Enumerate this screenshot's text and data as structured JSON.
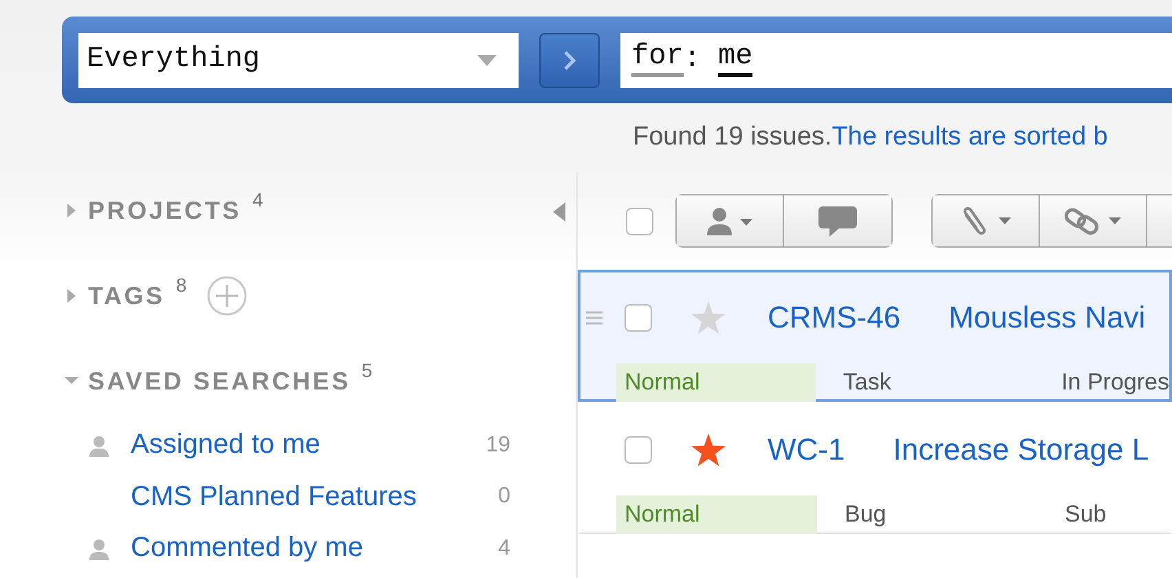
{
  "search": {
    "scope": "Everything",
    "query": [
      {
        "text": "for",
        "kind": "keyword"
      },
      {
        "text": ": ",
        "kind": "plain"
      },
      {
        "text": "me",
        "kind": "value"
      }
    ]
  },
  "results": {
    "count_text": "Found 19 issues.",
    "sort_text": "The results are sorted b"
  },
  "sidebar": {
    "sections": [
      {
        "title": "PROJECTS",
        "count": "4",
        "expanded": false
      },
      {
        "title": "TAGS",
        "count": "8",
        "expanded": false,
        "addable": true
      },
      {
        "title": "SAVED SEARCHES",
        "count": "5",
        "expanded": true,
        "items": [
          {
            "label": "Assigned to me",
            "count": "19",
            "personal": true
          },
          {
            "label": "CMS Planned Features",
            "count": "0",
            "personal": false
          },
          {
            "label": "Commented by me",
            "count": "4",
            "personal": true
          }
        ]
      }
    ]
  },
  "toolbar": {
    "select_all_checked": false
  },
  "issues": [
    {
      "id": "CRMS-46",
      "summary": "Mousless Navi",
      "priority": "Normal",
      "type": "Task",
      "state": "In Progres",
      "selected": true,
      "starred": false,
      "checked": false
    },
    {
      "id": "WC-1",
      "summary": "Increase Storage L",
      "priority": "Normal",
      "type": "Bug",
      "state": "Sub",
      "selected": false,
      "starred": true,
      "checked": false
    }
  ]
}
